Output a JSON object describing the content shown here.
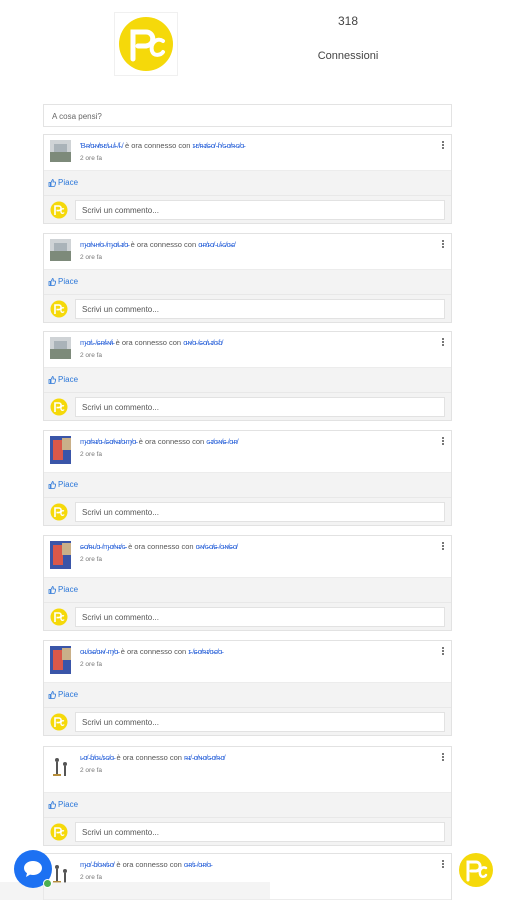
{
  "header": {
    "connections_count": "318",
    "connections_label": "Connessioni"
  },
  "composer": {
    "placeholder": "A cosa pensi?"
  },
  "feed": {
    "posts": [
      {
        "user": "Ɓ̴ʀ̸ɑ̴ɴ̸ʙ̴ᴇ̸ʟ̴ʟ̸ɨ̴ ̸ſ̴.̸",
        "connector": "è ora connesso con",
        "target": "ɪ̴ᴇ̸ʀ̴ɪ̸ɕ̴ɑ̸ ̴ɦ̸ɢ̴ɑ̸ʀ̴ɢ̸ɑ̴",
        "time": "2 ore fa",
        "like": "Piace",
        "comment_placeholder": "Scrivi un commento..."
      },
      {
        "user": "ɱ̴ɑ̸ɴ̴ʜ̸ɑ̴ ̸ɱ̴ɑ̸ʟ̴ɪ̸ɑ̴",
        "connector": "è ora connesso con",
        "target": "ɑ̴ʀ̸ɪ̴ɑ̸ ̴ʟ̸ɨ̴ɢ̸ɑ̴ɕ̸",
        "time": "2 ore fa",
        "like": "Piace",
        "comment_placeholder": "Scrivi un commento..."
      },
      {
        "user": "ɱ̴ɑ̸ʟ̴ ̸ɕ̴ʀ̸ɨ̴ɴ̸ɨ̴",
        "connector": "è ora connesso con",
        "target": "ɑ̴ɴ̸ɑ̴ ̸ɕ̴ɑ̸ʟ̴ɪ̸ɑ̴ɓ̸",
        "time": "2 ore fa",
        "like": "Piace",
        "comment_placeholder": "Scrivi un commento..."
      },
      {
        "user": "ɱ̴ɑ̸ʀ̴ɪ̸ɑ̴ ̸ɕ̴ɑ̸ɴ̴ɪ̸ɑ̴ɱ̸ɑ̴",
        "connector": "è ora connesso con",
        "target": "ɢ̴ɪ̸ɑ̴ɴ̸ɕ̴ ̸ɑ̴ʀ̸",
        "time": "2 ore fa",
        "like": "Piace",
        "comment_placeholder": "Scrivi un commento..."
      },
      {
        "user": "ɕ̴ɑ̸ʀ̴ʟ̸ɑ̴ ̸ɱ̴ɑ̸ɴ̴ɪ̸ɢ̴",
        "connector": "è ora connesso con",
        "target": "ɑ̴ɴ̸ɢ̴ɑ̸ɕ̴ ̸ɑ̴ɴ̸ɕ̴ɑ̸",
        "time": "2 ore fa",
        "like": "Piace",
        "comment_placeholder": "Scrivi un commento..."
      },
      {
        "user": "ɑ̴ʟ̸ɑ̴ɕ̸ɑ̴ɴ̸ ̴ɱ̸ɑ̴",
        "connector": "è ora connesso con",
        "target": "ɪ̴ ̸ɕ̴ɑ̸ʀ̴ɪ̸ɑ̴ɕ̸ɑ̴",
        "time": "2 ore fa",
        "like": "Piace",
        "comment_placeholder": "Scrivi un commento..."
      },
      {
        "user": "ʟ̴ɑ̸ ̴ɓ̸ɑ̴ʟ̸ɪ̴ɢ̸ɑ̴",
        "connector": "è ora connesso con",
        "target": "ʀ̴ɪ̸ ̴ɑ̸ɴ̴ɑ̸ɢ̴ɑ̸ʀ̴ɑ̸",
        "time": "2 ore fa",
        "like": "Piace",
        "comment_placeholder": "Scrivi un commento..."
      },
      {
        "user": "ɱ̴ɑ̸ ̴ɓ̸ɑ̴ɴ̸ɪ̴ɑ̸",
        "connector": "è ora connesso con",
        "target": "ɑ̴ʀ̸ɪ̴ ̸ɑ̴ʀ̸ɑ̴",
        "time": "2 ore fa",
        "like": "",
        "comment_placeholder": ""
      }
    ]
  },
  "colors": {
    "brand_yellow": "#f5d90a",
    "link_blue": "#2b63d9",
    "chat_blue": "#1d71f2",
    "online_green": "#4caf50"
  }
}
